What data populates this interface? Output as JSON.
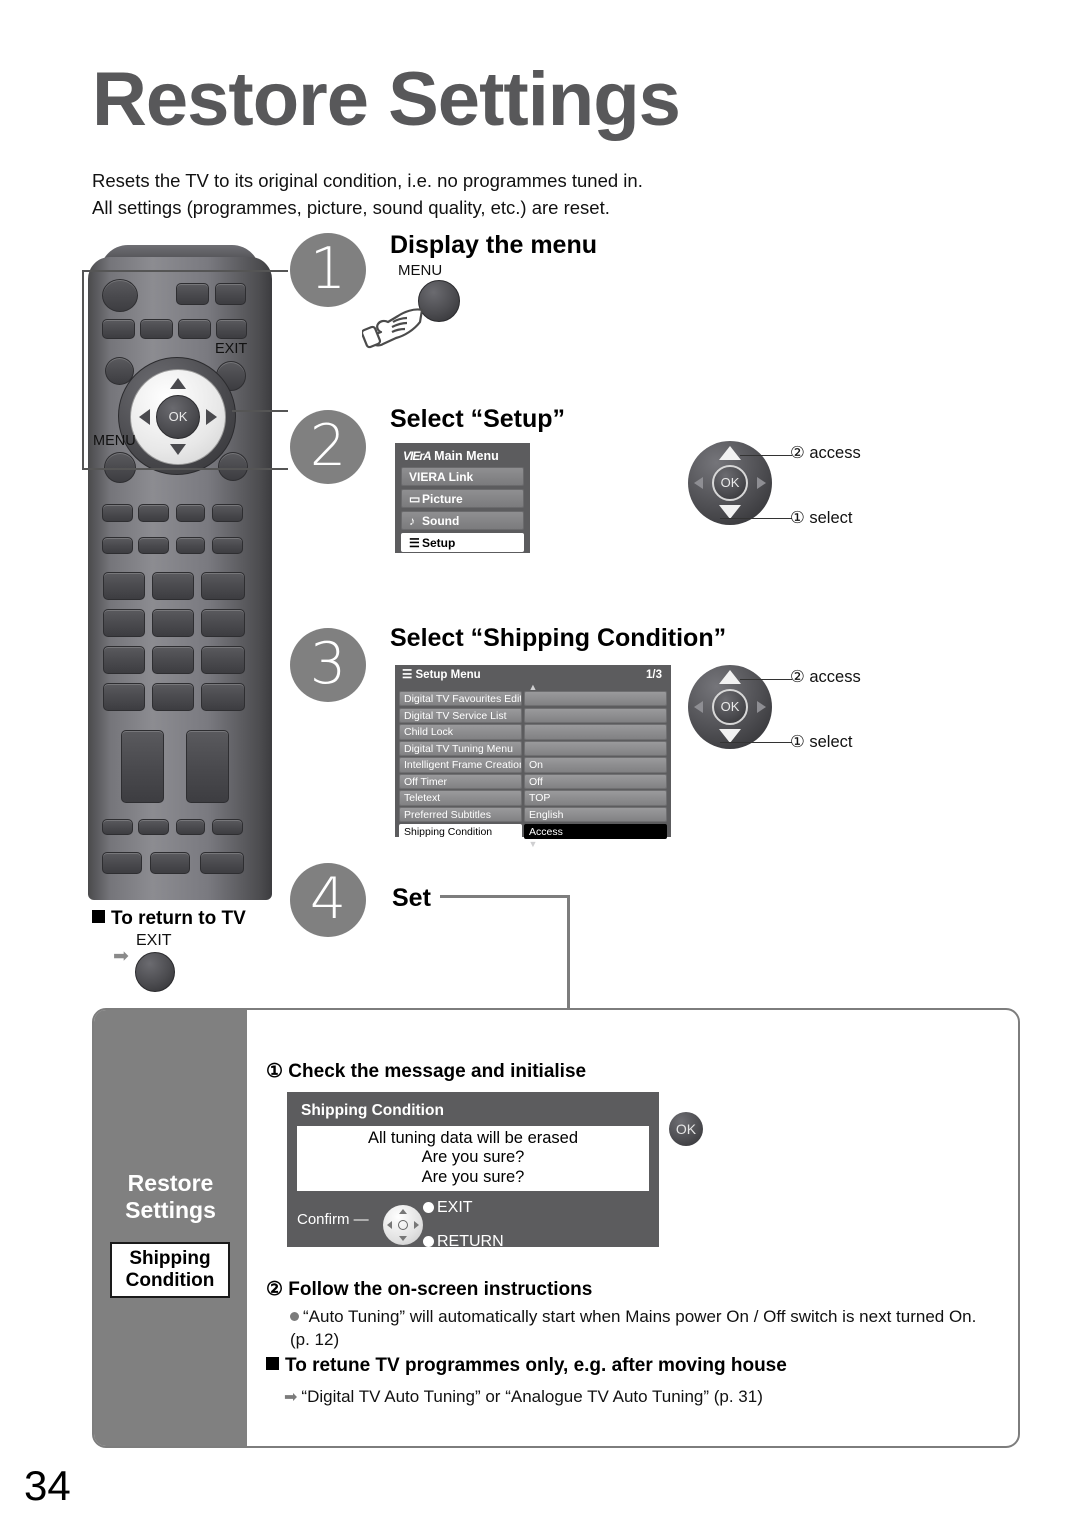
{
  "page": {
    "title": "Restore Settings",
    "intro_line1": "Resets the TV to its original condition, i.e. no programmes tuned in.",
    "intro_line2": "All settings (programmes, picture, sound quality, etc.) are reset.",
    "page_number": "34"
  },
  "steps": [
    {
      "num": "1",
      "heading": "Display the menu"
    },
    {
      "num": "2",
      "heading": "Select “Setup”"
    },
    {
      "num": "3",
      "heading": "Select “Shipping Condition”"
    },
    {
      "num": "4",
      "heading": "Set"
    }
  ],
  "remote": {
    "menu_label": "MENU",
    "exit_label": "EXIT",
    "ok_label": "OK"
  },
  "step1": {
    "button_label": "MENU"
  },
  "viera_menu": {
    "logo": "VIErA",
    "title": "Main Menu",
    "items": [
      {
        "icon": "",
        "label": "VIERA Link",
        "selected": false
      },
      {
        "icon": "picture-icon",
        "label": "Picture",
        "selected": false
      },
      {
        "icon": "sound-icon",
        "label": "Sound",
        "selected": false
      },
      {
        "icon": "list-icon",
        "label": "Setup",
        "selected": true
      }
    ]
  },
  "setup_menu": {
    "title": "Setup Menu",
    "page_indicator": "1/3",
    "rows": [
      {
        "key": "Digital TV Favourites Edit",
        "value": "",
        "selected": false
      },
      {
        "key": "Digital TV Service List",
        "value": "",
        "selected": false
      },
      {
        "key": "Child Lock",
        "value": "",
        "selected": false
      },
      {
        "key": "Digital TV Tuning Menu",
        "value": "",
        "selected": false
      },
      {
        "key": "Intelligent Frame Creation",
        "value": "On",
        "selected": false
      },
      {
        "key": "Off Timer",
        "value": "Off",
        "selected": false
      },
      {
        "key": "Teletext",
        "value": "TOP",
        "selected": false
      },
      {
        "key": "Preferred Subtitles",
        "value": "English",
        "selected": false
      },
      {
        "key": "Shipping Condition",
        "value": "Access",
        "selected": true
      }
    ]
  },
  "nav_rings": [
    {
      "ok": "OK",
      "access": "② access",
      "select": "① select"
    },
    {
      "ok": "OK",
      "access": "② access",
      "select": "① select"
    }
  ],
  "return_to_tv": {
    "heading": "To return to TV",
    "exit_label": "EXIT"
  },
  "panel": {
    "side_title_line1": "Restore",
    "side_title_line2": "Settings",
    "side_box_line1": "Shipping",
    "side_box_line2": "Condition",
    "sub1_title": "① Check the message and initialise",
    "sub2_title": "② Follow the on-screen instructions",
    "sub2_bullet": "“Auto Tuning” will automatically start when Mains power On / Off switch is next turned On. (p. 12)",
    "sub3_title": "To retune TV programmes only, e.g. after moving house",
    "sub3_bullet": "“Digital TV Auto Tuning” or “Analogue TV Auto Tuning” (p. 31)"
  },
  "dialog": {
    "title": "Shipping Condition",
    "msg_line1": "All tuning data will be erased",
    "msg_line2": "Are you sure?",
    "msg_line3": "Are you sure?",
    "confirm_label": "Confirm",
    "exit_label": "EXIT",
    "return_label": "RETURN",
    "ok_badge": "OK"
  },
  "colors": {
    "accent_gray": "#808080",
    "title_gray": "#58585a",
    "menu_bg": "#5c5c5e",
    "row_gray": "#8f8f91"
  }
}
